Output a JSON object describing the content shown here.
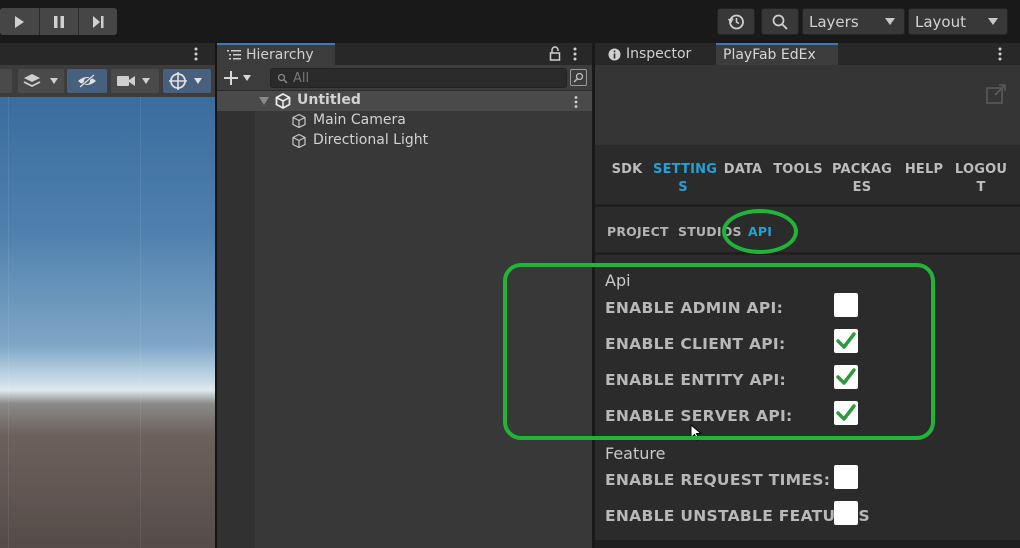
{
  "toolbar": {
    "play_icon": "play-icon",
    "pause_icon": "pause-icon",
    "step_icon": "step-icon",
    "history_icon": "history-icon",
    "search_icon": "search-icon",
    "layers_label": "Layers",
    "layout_label": "Layout"
  },
  "hierarchy": {
    "tab_label": "Hierarchy",
    "search_placeholder": "All",
    "scene_name": "Untitled",
    "items": [
      {
        "label": "Main Camera"
      },
      {
        "label": "Directional Light"
      }
    ]
  },
  "inspector": {
    "tab_label": "Inspector",
    "playfab_tab_label": "PlayFab EdEx"
  },
  "playfab": {
    "nav": [
      {
        "line1": "SDK",
        "line2": ""
      },
      {
        "line1": "SETTING",
        "line2": "S"
      },
      {
        "line1": "DATA",
        "line2": ""
      },
      {
        "line1": "TOOLS",
        "line2": ""
      },
      {
        "line1": "PACKAG",
        "line2": "ES"
      },
      {
        "line1": "HELP",
        "line2": ""
      },
      {
        "line1": "LOGOU",
        "line2": "T"
      }
    ],
    "active_nav": "SETTINGS",
    "subnav": [
      "PROJECT",
      "STUDIOS",
      "API"
    ],
    "active_subnav": "API",
    "api_section_title": "Api",
    "api_options": [
      {
        "label": "ENABLE ADMIN API:",
        "checked": false
      },
      {
        "label": "ENABLE CLIENT API:",
        "checked": true
      },
      {
        "label": "ENABLE ENTITY API:",
        "checked": true
      },
      {
        "label": "ENABLE SERVER API:",
        "checked": true
      }
    ],
    "feature_section_title": "Feature",
    "feature_options": [
      {
        "label": "ENABLE REQUEST TIMES:",
        "checked": false
      },
      {
        "label": "ENABLE UNSTABLE FEATURES",
        "checked": false
      }
    ]
  },
  "colors": {
    "accent_blue": "#25a0d6",
    "annotation_green": "#1fb538",
    "check_green": "#2e9a3c"
  }
}
